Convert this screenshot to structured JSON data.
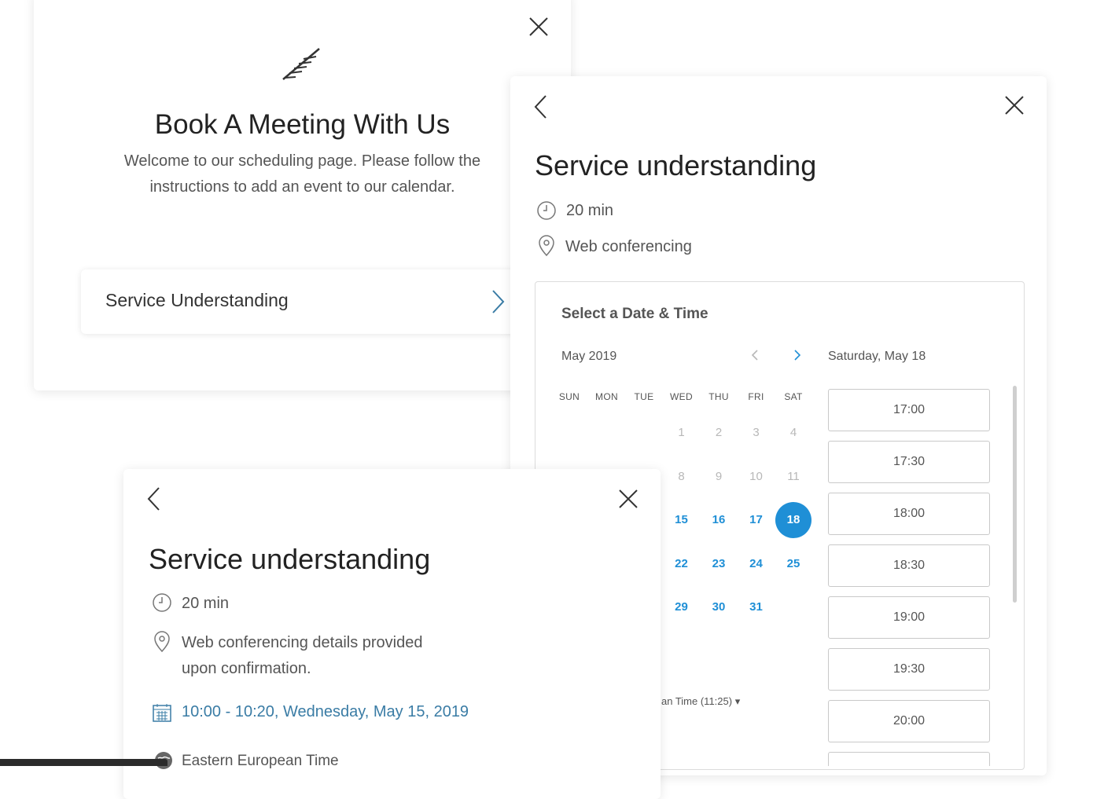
{
  "landing": {
    "title": "Book A Meeting With Us",
    "welcome": "Welcome to our scheduling page. Please follow the instructions to add an event to our calendar.",
    "service_label": "Service Understanding"
  },
  "event": {
    "title": "Service understanding",
    "duration": "20 min",
    "location": "Web conferencing"
  },
  "picker": {
    "heading": "Select a Date & Time",
    "month": "May 2019",
    "selected_date": "Saturday, May 18",
    "weekdays": [
      "SUN",
      "MON",
      "TUE",
      "WED",
      "THU",
      "FRI",
      "SAT"
    ],
    "days": [
      {
        "d": "1",
        "state": "muted",
        "col": 3,
        "row": 0
      },
      {
        "d": "2",
        "state": "muted",
        "col": 4,
        "row": 0
      },
      {
        "d": "3",
        "state": "muted",
        "col": 5,
        "row": 0
      },
      {
        "d": "4",
        "state": "muted",
        "col": 6,
        "row": 0
      },
      {
        "d": "8",
        "state": "muted",
        "col": 3,
        "row": 1
      },
      {
        "d": "9",
        "state": "muted",
        "col": 4,
        "row": 1
      },
      {
        "d": "10",
        "state": "muted",
        "col": 5,
        "row": 1
      },
      {
        "d": "11",
        "state": "muted",
        "col": 6,
        "row": 1
      },
      {
        "d": "15",
        "state": "avail",
        "col": 3,
        "row": 2
      },
      {
        "d": "16",
        "state": "avail",
        "col": 4,
        "row": 2
      },
      {
        "d": "17",
        "state": "avail",
        "col": 5,
        "row": 2
      },
      {
        "d": "18",
        "state": "selected",
        "col": 6,
        "row": 2
      },
      {
        "d": "22",
        "state": "avail",
        "col": 3,
        "row": 3
      },
      {
        "d": "23",
        "state": "avail",
        "col": 4,
        "row": 3
      },
      {
        "d": "24",
        "state": "avail",
        "col": 5,
        "row": 3
      },
      {
        "d": "25",
        "state": "avail",
        "col": 6,
        "row": 3
      },
      {
        "d": "29",
        "state": "avail",
        "col": 3,
        "row": 4
      },
      {
        "d": "30",
        "state": "avail",
        "col": 4,
        "row": 4
      },
      {
        "d": "31",
        "state": "avail",
        "col": 5,
        "row": 4
      }
    ],
    "timezone_partial": "an Time (11:25)",
    "slots": [
      "17:00",
      "17:30",
      "18:00",
      "18:30",
      "19:00",
      "19:30",
      "20:00"
    ]
  },
  "confirm": {
    "title": "Service understanding",
    "duration": "20 min",
    "location_line1": "Web conferencing details provided",
    "location_line2": "upon confirmation.",
    "datetime": "10:00 - 10:20, Wednesday, May 15, 2019",
    "timezone": "Eastern European Time"
  },
  "colors": {
    "accent": "#1f8fd6",
    "datetime_text": "#3a7ca5"
  },
  "icons": [
    "close-icon",
    "back-icon",
    "chevron-right-icon",
    "clock-icon",
    "location-pin-icon",
    "calendar-icon",
    "globe-icon",
    "logo-icon",
    "caret-down-icon"
  ]
}
